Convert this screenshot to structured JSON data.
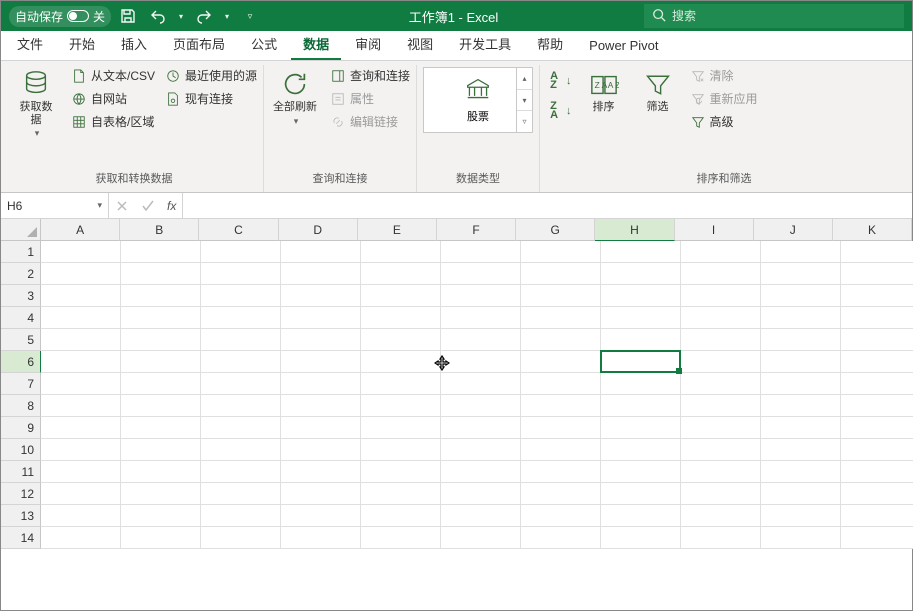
{
  "titlebar": {
    "autosave_label": "自动保存",
    "autosave_state": "关",
    "window_title": "工作簿1  -  Excel",
    "search_placeholder": "搜索"
  },
  "ribbon_tabs": [
    {
      "id": "file",
      "label": "文件"
    },
    {
      "id": "home",
      "label": "开始"
    },
    {
      "id": "insert",
      "label": "插入"
    },
    {
      "id": "layout",
      "label": "页面布局"
    },
    {
      "id": "formulas",
      "label": "公式"
    },
    {
      "id": "data",
      "label": "数据",
      "active": true
    },
    {
      "id": "review",
      "label": "审阅"
    },
    {
      "id": "view",
      "label": "视图"
    },
    {
      "id": "developer",
      "label": "开发工具"
    },
    {
      "id": "help",
      "label": "帮助"
    },
    {
      "id": "powerpivot",
      "label": "Power Pivot"
    }
  ],
  "ribbon": {
    "group_get_transform": {
      "label": "获取和转换数据",
      "get_data": "获取数\n据",
      "from_csv": "从文本/CSV",
      "from_web": "自网站",
      "from_table": "自表格/区域",
      "recent_sources": "最近使用的源",
      "existing_conn": "现有连接"
    },
    "group_queries": {
      "label": "查询和连接",
      "refresh_all": "全部刷新",
      "queries_conn": "查询和连接",
      "properties": "属性",
      "edit_links": "编辑链接"
    },
    "group_datatypes": {
      "label": "数据类型",
      "stock": "股票"
    },
    "group_sortfilter": {
      "label": "排序和筛选",
      "sort": "排序",
      "filter": "筛选",
      "clear": "清除",
      "reapply": "重新应用",
      "advanced": "高级"
    }
  },
  "formula_bar": {
    "name_box": "H6",
    "fx_label": "fx",
    "formula_value": ""
  },
  "grid": {
    "columns": [
      "A",
      "B",
      "C",
      "D",
      "E",
      "F",
      "G",
      "H",
      "I",
      "J",
      "K"
    ],
    "rows": [
      1,
      2,
      3,
      4,
      5,
      6,
      7,
      8,
      9,
      10,
      11,
      12,
      13,
      14
    ],
    "active_cell": {
      "col": "H",
      "row": 6,
      "col_index": 7,
      "row_index": 5
    }
  }
}
